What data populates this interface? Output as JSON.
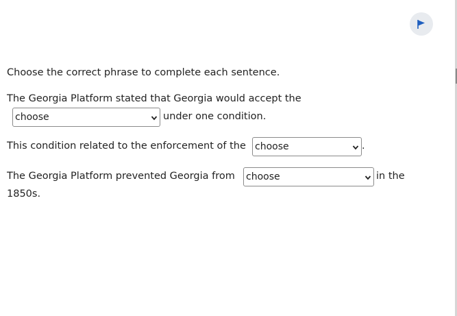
{
  "flag_button": {
    "icon": "flag-icon",
    "color": "#1f5fbf"
  },
  "instructions": "Choose the correct phrase to complete each sentence.",
  "questions": [
    {
      "line1": "The Georgia Platform stated that Georgia would accept the",
      "dropdown_value": "choose",
      "after": "under one condition."
    },
    {
      "before": "This condition related to the enforcement of the",
      "dropdown_value": "choose",
      "after": "."
    },
    {
      "before": "The Georgia Platform prevented Georgia from",
      "dropdown_value": "choose",
      "after": "in the",
      "line2": "1850s."
    }
  ]
}
